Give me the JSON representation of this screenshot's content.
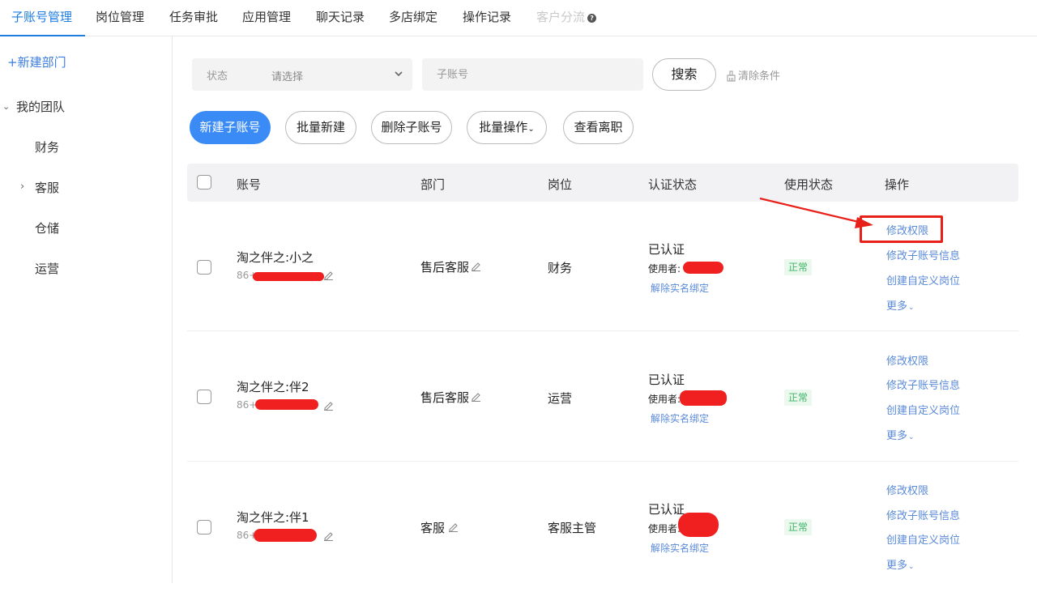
{
  "nav": {
    "tabs": [
      {
        "label": "子账号管理"
      },
      {
        "label": "岗位管理"
      },
      {
        "label": "任务审批"
      },
      {
        "label": "应用管理"
      },
      {
        "label": "聊天记录"
      },
      {
        "label": "多店绑定"
      },
      {
        "label": "操作记录"
      },
      {
        "label": "客户分流"
      }
    ],
    "active_tab": "子账号管理",
    "disabled_tab": "客户分流",
    "help_icon": "question-circle-icon"
  },
  "sidebar": {
    "new_dept": "+新建部门",
    "team": "我的团队",
    "items": [
      "财务",
      "客服",
      "仓储",
      "运营"
    ]
  },
  "filters": {
    "status_label": "状态",
    "status_placeholder": "请选择",
    "account_placeholder": "子账号",
    "search": "搜索",
    "clear": "清除条件"
  },
  "actions": {
    "new_sub": "新建子账号",
    "batch_new": "批量新建",
    "delete_sub": "删除子账号",
    "batch_ops": "批量操作",
    "view_resigned": "查看离职"
  },
  "table": {
    "headers": [
      "账号",
      "部门",
      "岗位",
      "认证状态",
      "使用状态",
      "操作"
    ],
    "rows": [
      {
        "name": "淘之伴之:小之",
        "phone": "86+",
        "dept": "售后客服",
        "position": "财务",
        "auth": "已认证",
        "user_label": "使用者:",
        "unbind": "解除实名绑定",
        "status": "正常"
      },
      {
        "name": "淘之伴之:伴2",
        "phone": "86+",
        "dept": "售后客服",
        "position": "运营",
        "auth": "已认证",
        "user_label": "使用者:",
        "unbind": "解除实名绑定",
        "status": "正常"
      },
      {
        "name": "淘之伴之:伴1",
        "phone": "86+",
        "dept": "客服",
        "position": "客服主管",
        "auth": "已认证",
        "user_label": "使用者:",
        "unbind": "解除实名绑定",
        "status": "正常"
      }
    ],
    "ops": {
      "edit_perm": "修改权限",
      "edit_info": "修改子账号信息",
      "create_position": "创建自定义岗位",
      "more": "更多"
    }
  },
  "colors": {
    "accent": "#1f7de0",
    "primary_button": "#3a8bf6",
    "link": "#5a8ad8",
    "status_ok": "#3fb465",
    "annotation": "#e8201a"
  }
}
